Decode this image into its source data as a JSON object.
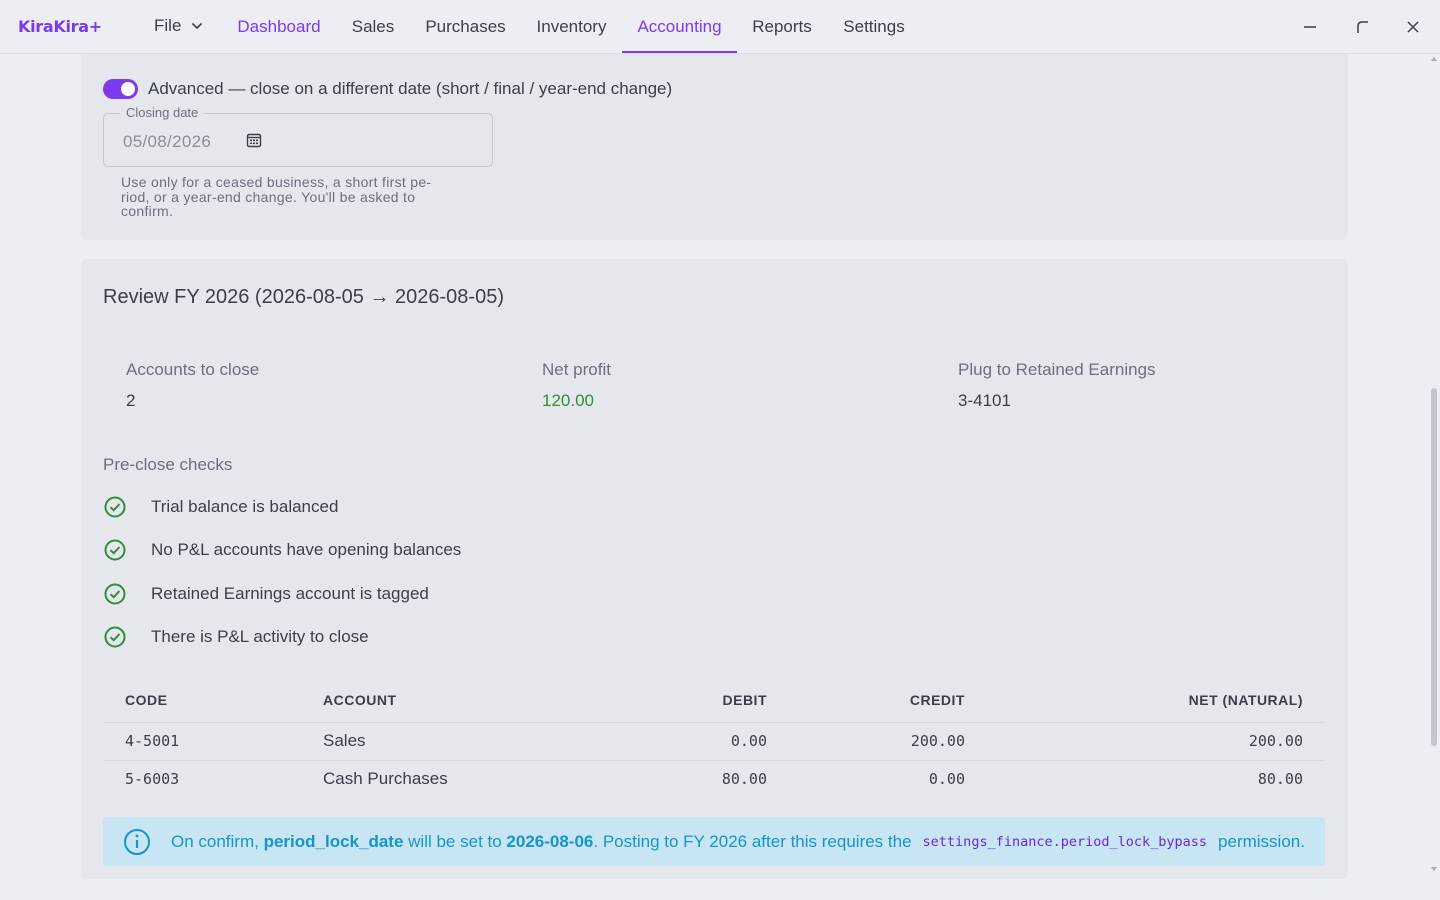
{
  "app": {
    "brand": "KiraKira+"
  },
  "menu": {
    "file_label": "File"
  },
  "nav": {
    "tabs": [
      {
        "label": "Dashboard"
      },
      {
        "label": "Sales"
      },
      {
        "label": "Purchases"
      },
      {
        "label": "Inventory"
      },
      {
        "label": "Accounting"
      },
      {
        "label": "Reports"
      },
      {
        "label": "Settings"
      }
    ],
    "active": "Accounting"
  },
  "window_controls": {
    "minimize_icon": "minimize-icon",
    "restore_icon": "restore-icon",
    "close_icon": "close-icon"
  },
  "close_options": {
    "advanced_toggle": {
      "label": "Advanced — close on a different date (short / final / year-end change)",
      "checked": true
    },
    "closing_date": {
      "label": "Closing date",
      "value": "05/08/2026"
    },
    "helper_line1": "Use only for a ceased business, a short first pe-",
    "helper_line2": "riod, or a year-end change. You'll be asked to",
    "helper_line3": "confirm."
  },
  "review": {
    "title": "Review FY 2026 (2026-08-05 → 2026-08-05)",
    "stats": {
      "accounts_label": "Accounts to close",
      "accounts_value": "2",
      "net_profit_label": "Net profit",
      "net_profit_value": "120.00",
      "plug_label": "Plug to Retained Earnings",
      "plug_value": "3-4101"
    },
    "checks_title": "Pre-close checks",
    "checks": [
      {
        "label": "Trial balance is balanced",
        "status": "ok"
      },
      {
        "label": "No P&L accounts have opening balances",
        "status": "ok"
      },
      {
        "label": "Retained Earnings account is tagged",
        "status": "ok"
      },
      {
        "label": "There is P&L activity to close",
        "status": "ok"
      }
    ],
    "table": {
      "headers": {
        "code": "CODE",
        "account": "ACCOUNT",
        "debit": "DEBIT",
        "credit": "CREDIT",
        "net": "NET (NATURAL)"
      },
      "rows": [
        {
          "code": "4-5001",
          "account": "Sales",
          "debit": "0.00",
          "credit": "200.00",
          "net": "200.00"
        },
        {
          "code": "5-6003",
          "account": "Cash Purchases",
          "debit": "80.00",
          "credit": "0.00",
          "net": "80.00"
        }
      ]
    },
    "info": {
      "part1": "On confirm, ",
      "field": "period_lock_date",
      "part2": " will be set to ",
      "date": "2026-08-06",
      "part3": ". Posting to FY 2026 after this requires the",
      "permission": "settings_finance.period_lock_bypass",
      "part4": "permission."
    }
  },
  "colors": {
    "accent": "#7c3aed",
    "success": "#2f8f3a",
    "info_text": "#1596c7",
    "info_bg": "#c7e5f2"
  }
}
